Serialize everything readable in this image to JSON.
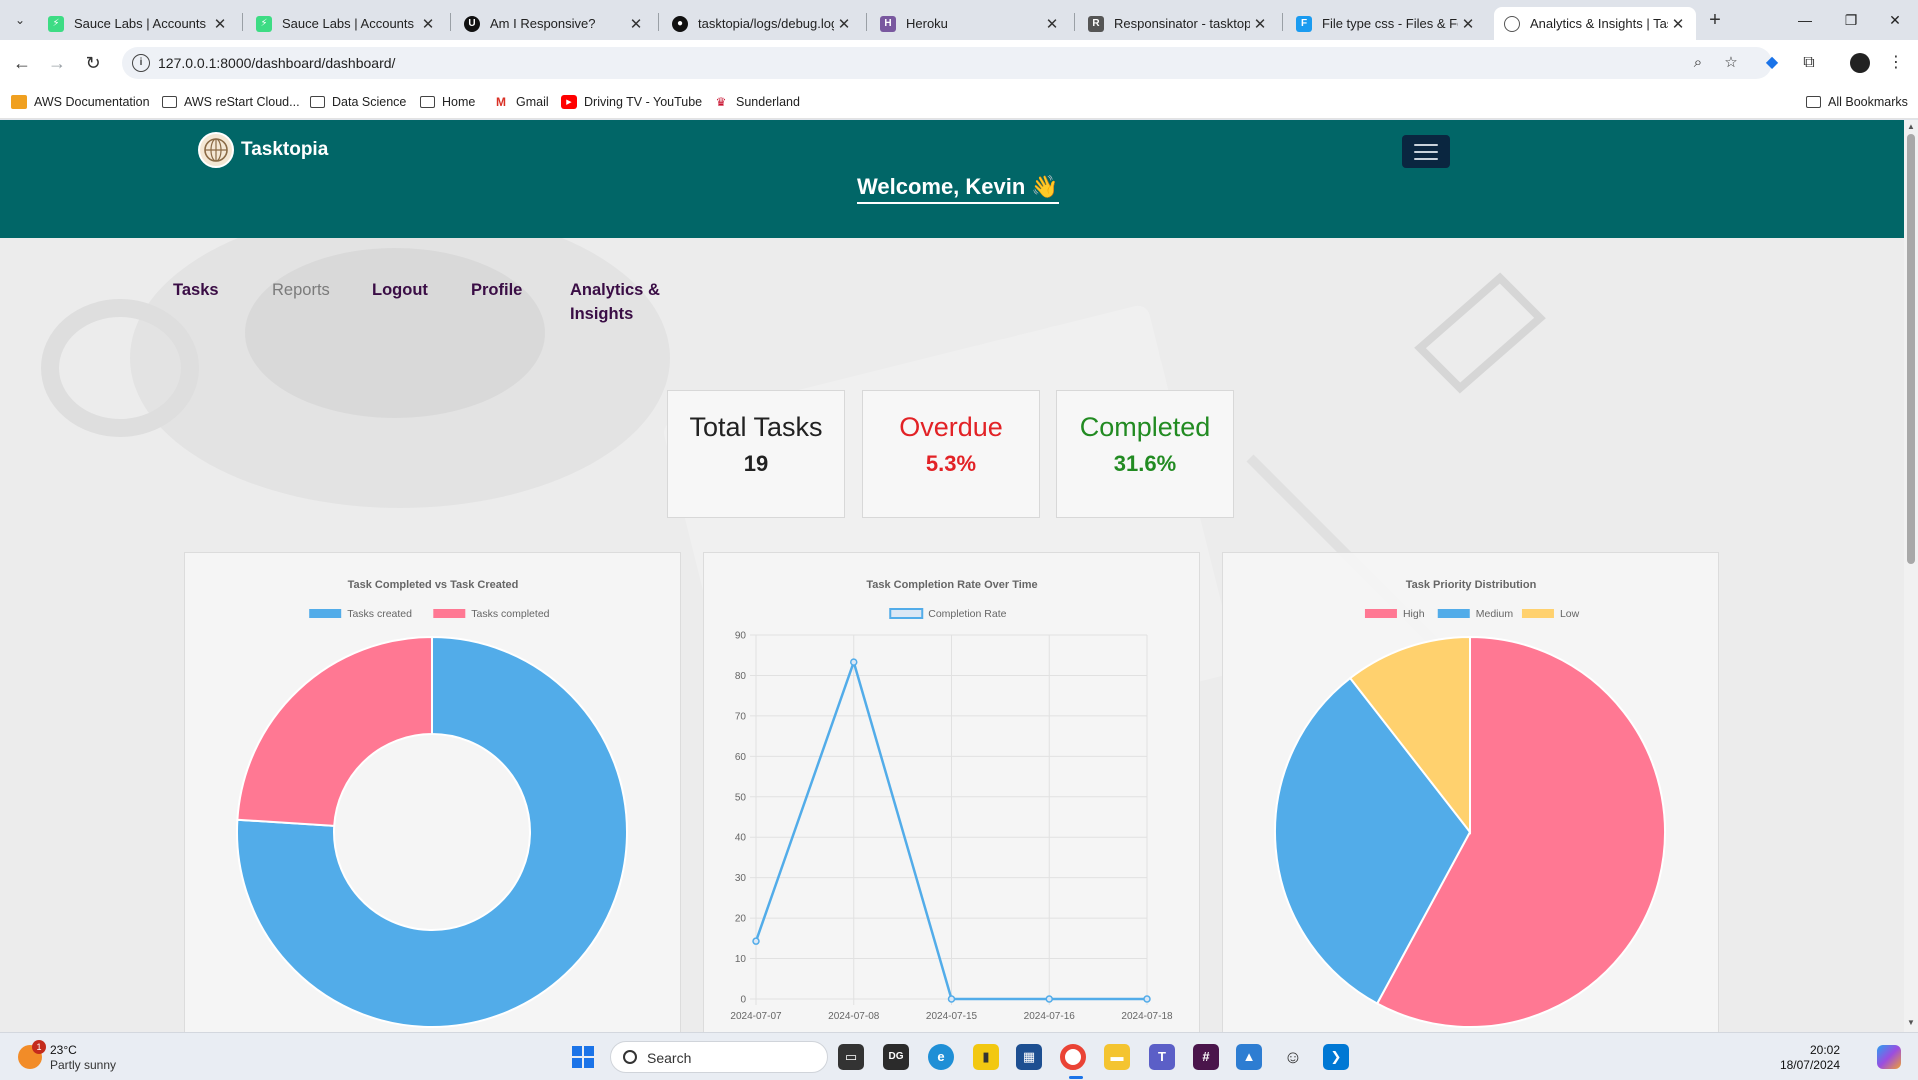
{
  "browser": {
    "tabs": [
      {
        "title": "Sauce Labs | Accounts",
        "icon": "saucelabs-icon",
        "active": false
      },
      {
        "title": "Sauce Labs | Accounts",
        "icon": "saucelabs-icon",
        "active": false
      },
      {
        "title": "Am I Responsive?",
        "icon": "amiresponsive-icon",
        "active": false
      },
      {
        "title": "tasktopia/logs/debug.log",
        "icon": "github-icon",
        "active": false
      },
      {
        "title": "Heroku",
        "icon": "heroku-icon",
        "active": false
      },
      {
        "title": "Responsinator - tasktopia",
        "icon": "responsinator-icon",
        "active": false
      },
      {
        "title": "File type css - Files & Fold",
        "icon": "file-icon",
        "active": false
      },
      {
        "title": "Analytics & Insights | Task",
        "icon": "globe-icon",
        "active": true
      }
    ],
    "url": "127.0.0.1:8000/dashboard/dashboard/",
    "bookmarks": [
      "AWS Documentation",
      "AWS reStart Cloud...",
      "Data Science",
      "Home",
      "Gmail",
      "Driving TV - YouTube",
      "Sunderland"
    ],
    "all_bookmarks": "All Bookmarks"
  },
  "header": {
    "brand": "Tasktopia",
    "welcome": "Welcome, Kevin 👋"
  },
  "nav": {
    "tasks": "Tasks",
    "reports": "Reports",
    "logout": "Logout",
    "profile": "Profile",
    "analytics_line1": "Analytics &",
    "analytics_line2": "Insights"
  },
  "stats": {
    "total": {
      "label": "Total Tasks",
      "value": "19"
    },
    "overdue": {
      "label": "Overdue",
      "value": "5.3%"
    },
    "completed": {
      "label": "Completed",
      "value": "31.6%"
    }
  },
  "colors": {
    "header_bg": "#016667",
    "blue": "#52ace9",
    "pink": "#ff7893",
    "yellow": "#ffd16e",
    "overdue": "#e22226",
    "completed": "#228b22"
  },
  "chart_data": [
    {
      "type": "pie",
      "variant": "doughnut",
      "title": "Task Completed vs Task Created",
      "categories": [
        "Tasks created",
        "Tasks completed"
      ],
      "values": [
        19,
        6
      ],
      "colors": [
        "#52ace9",
        "#ff7893"
      ],
      "legend": "top"
    },
    {
      "type": "line",
      "title": "Task Completion Rate Over Time",
      "x": [
        "2024-07-07",
        "2024-07-08",
        "2024-07-15",
        "2024-07-16",
        "2024-07-18"
      ],
      "series": [
        {
          "name": "Completion Rate",
          "values": [
            14.3,
            83.3,
            0,
            0,
            0
          ]
        }
      ],
      "ylim": [
        0,
        90
      ],
      "yticks": [
        "0",
        "10",
        "20",
        "30",
        "40",
        "50",
        "60",
        "70",
        "80",
        "90"
      ],
      "grid": true,
      "legend": "top"
    },
    {
      "type": "pie",
      "title": "Task Priority Distribution",
      "categories": [
        "High",
        "Medium",
        "Low"
      ],
      "values": [
        11,
        6,
        2
      ],
      "colors": [
        "#ff7893",
        "#52ace9",
        "#ffd16e"
      ],
      "legend": "top"
    }
  ],
  "taskbar": {
    "temp": "23°C",
    "weather": "Partly sunny",
    "weather_badge": "1",
    "search": "Search",
    "time": "20:02",
    "date": "18/07/2024"
  }
}
